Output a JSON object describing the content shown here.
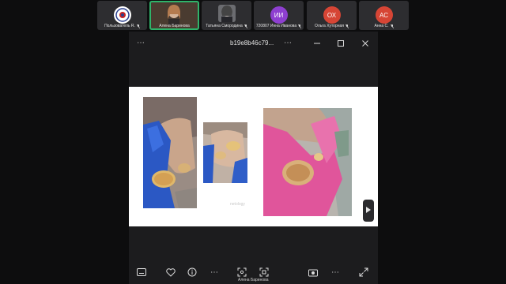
{
  "participants": [
    {
      "name": "Пользователь R.",
      "initials": "",
      "color": "#2d2d30"
    },
    {
      "name": "Алена Баринова",
      "initials": "",
      "color": "#2d2d30"
    },
    {
      "name": "Татьяна Смородина",
      "initials": "",
      "color": "#2d2d30"
    },
    {
      "name": "720807 Инна Иванова",
      "initials": "ИИ",
      "color": "#8e3fd0"
    },
    {
      "name": "Ольга Хуторная",
      "initials": "ОХ",
      "color": "#d64535"
    },
    {
      "name": "Анна С.",
      "initials": "АС",
      "color": "#d64535"
    }
  ],
  "viewer": {
    "title": "b19e8b46c79...",
    "more_label": "⋯",
    "watermark": "netology"
  },
  "bottom": {
    "caption": "Алена Баринова"
  },
  "icons": [
    "more-icon",
    "minimize-icon",
    "maximize-icon",
    "close-icon",
    "next-slide-icon",
    "captions-icon",
    "heart-icon",
    "info-icon",
    "crop-icon",
    "screenshot-icon",
    "camera-icon",
    "expand-icon"
  ]
}
